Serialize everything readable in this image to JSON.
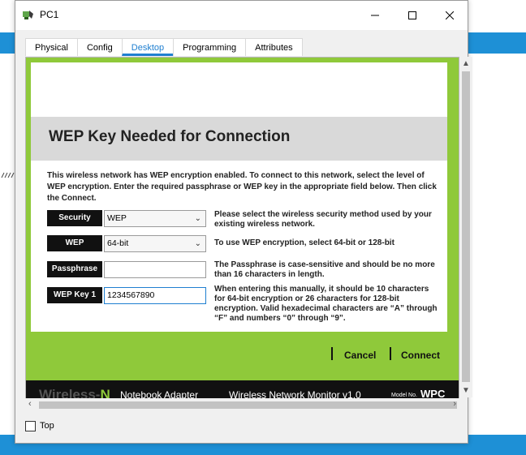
{
  "window": {
    "title": "PC1"
  },
  "tabs": [
    {
      "label": "Physical"
    },
    {
      "label": "Config"
    },
    {
      "label": "Desktop",
      "active": true
    },
    {
      "label": "Programming"
    },
    {
      "label": "Attributes"
    }
  ],
  "dialog": {
    "heading": "WEP Key Needed for Connection",
    "description": "This wireless network has WEP encryption enabled. To connect to this network, select the level of WEP encryption. Enter the required passphrase or WEP key in the appropriate field below. Then click the Connect.",
    "fields": {
      "security": {
        "label": "Security",
        "value": "WEP",
        "help": "Please select the wireless security method used by your existing wireless network."
      },
      "wep": {
        "label": "WEP",
        "value": "64-bit",
        "help": "To use WEP encryption, select 64-bit or 128-bit"
      },
      "passphrase": {
        "label": "Passphrase",
        "value": "",
        "help": "The Passphrase is case-sensitive and should be no more than 16 characters in length."
      },
      "wep_key1": {
        "label": "WEP Key 1",
        "value": "1234567890",
        "help": "When entering this manually, it should be 10 characters for 64-bit encryption or 26 characters for 128-bit encryption. Valid hexadecimal characters are “A” through “F” and numbers “0”  through “9”."
      }
    },
    "cancel_label": "Cancel",
    "connect_label": "Connect"
  },
  "footer": {
    "brand_prefix": "Wireless-",
    "brand_suffix": "N",
    "product": "Notebook Adapter",
    "monitor": "Wireless Network Monitor  v1.0",
    "model_label": "Model No.",
    "model": "WPC"
  },
  "options": {
    "top_label": "Top",
    "top_checked": false
  },
  "colors": {
    "accent": "#1f7fd0",
    "green": "#8fc93a",
    "footer": "#111111"
  },
  "icons": [
    "pc-icon",
    "minimize-icon",
    "maximize-icon",
    "close-icon",
    "chevron-down-icon"
  ]
}
